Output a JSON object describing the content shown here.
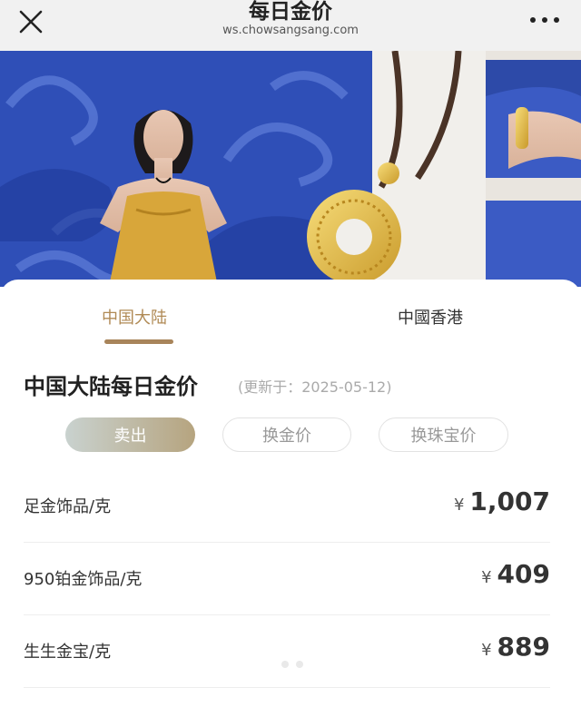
{
  "header": {
    "title": "每日金价",
    "url": "ws.chowsangsang.com"
  },
  "tabs": {
    "mainland": "中国大陆",
    "hongkong": "中國香港"
  },
  "section": {
    "title": "中国大陆每日金价",
    "updated": "(更新于：2025-05-12)"
  },
  "filters": {
    "sell": "卖出",
    "exchange_gold": "换金价",
    "exchange_jewelry": "换珠宝价"
  },
  "currency_symbol": "¥",
  "prices": [
    {
      "label": "足金饰品/克",
      "value": "1,007"
    },
    {
      "label": "950铂金饰品/克",
      "value": "409"
    },
    {
      "label": "生生金宝/克",
      "value": "889"
    }
  ],
  "colors": {
    "accent_gold": "#b08a55",
    "banner_blue": "#2f4fb7"
  }
}
